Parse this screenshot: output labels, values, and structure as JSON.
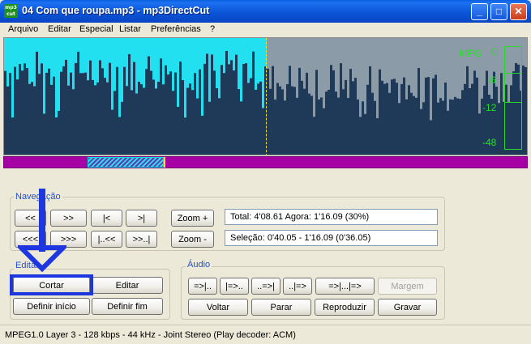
{
  "window": {
    "title": "04 Com que roupa.mp3 - mp3DirectCut",
    "app_icon_text": "mp3\ncut",
    "controls": {
      "minimize": "_",
      "maximize": "□",
      "close": "✕"
    }
  },
  "menu": [
    "Arquivo",
    "Editar",
    "Especial",
    "Listar",
    "Preferências",
    "?"
  ],
  "meter": {
    "labels": [
      "0",
      "-6",
      "-12",
      "-48"
    ],
    "tag": "MPG",
    "color": "#24E024"
  },
  "waveform": {
    "selected_color": "#22E0F0",
    "unselected_color": "#8C9BA8",
    "background": "#1E3A58"
  },
  "navigation": {
    "title": "Navegação",
    "buttons_row1": [
      "<<",
      ">>",
      "|<",
      ">|"
    ],
    "buttons_row2": [
      "<<<",
      ">>>",
      "|..<<",
      ">>..|"
    ],
    "zoom_in": "Zoom +",
    "zoom_out": "Zoom -",
    "info_total": "Total: 4'08.61   Agora: 1'16.09   (30%)",
    "info_selection": "Seleção: 0'40.05 - 1'16.09 (0'36.05)"
  },
  "edit": {
    "title": "Editar",
    "cut": "Cortar",
    "edit": "Editar",
    "set_start": "Definir início",
    "set_end": "Definir fim"
  },
  "audio": {
    "title": "Áudio",
    "buttons_row1": [
      "=>|..",
      "|=>..",
      "..=>|",
      "..|=>",
      "=>|...|=>"
    ],
    "margin": "Margem",
    "back": "Voltar",
    "stop": "Parar",
    "play": "Reproduzir",
    "record": "Gravar"
  },
  "status": "MPEG1.0 Layer 3 - 128 kbps - 44 kHz - Joint Stereo    (Play decoder: ACM)",
  "annotation_color": "#1E36E0"
}
